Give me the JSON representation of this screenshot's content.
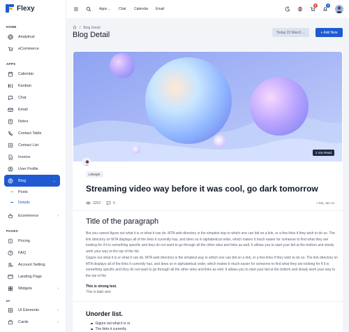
{
  "app": {
    "name": "Flexy"
  },
  "sidebar": {
    "sections": {
      "home": "HOME",
      "apps": "APPS",
      "pages": "PAGES",
      "ui": "UI"
    },
    "home_items": [
      {
        "label": "Analytical",
        "icon": "aperture-icon"
      },
      {
        "label": "eCommerce",
        "icon": "shopping-cart-icon"
      }
    ],
    "apps_items": [
      {
        "label": "Calendar",
        "icon": "calendar-icon"
      },
      {
        "label": "Kanban",
        "icon": "kanban-icon"
      },
      {
        "label": "Chat",
        "icon": "message-icon"
      },
      {
        "label": "Email",
        "icon": "mail-icon"
      },
      {
        "label": "Notes",
        "icon": "notes-icon"
      },
      {
        "label": "Contact Table",
        "icon": "phone-icon"
      },
      {
        "label": "Contact List",
        "icon": "list-icon"
      },
      {
        "label": "Invoice",
        "icon": "invoice-icon"
      },
      {
        "label": "User Profile",
        "icon": "user-circle-icon"
      },
      {
        "label": "Blog",
        "icon": "chart-donut-icon"
      }
    ],
    "blog_sub": [
      {
        "label": "Posts"
      },
      {
        "label": "Details"
      }
    ],
    "ecommerce_label": "Ecommerce",
    "pages_items": [
      {
        "label": "Pricing",
        "icon": "currency-icon"
      },
      {
        "label": "FAQ",
        "icon": "help-icon"
      },
      {
        "label": "Account Setting",
        "icon": "user-settings-icon"
      },
      {
        "label": "Landing Page",
        "icon": "app-window-icon"
      },
      {
        "label": "Widgets",
        "icon": "layout-icon"
      }
    ],
    "ui_items": [
      {
        "label": "UI Elements",
        "icon": "layout-grid-icon"
      },
      {
        "label": "Cards",
        "icon": "cards-icon"
      }
    ]
  },
  "topbar": {
    "links": [
      "Apps",
      "Chat",
      "Calendar",
      "Email"
    ],
    "cart_count": "5",
    "notif_count": "3"
  },
  "page": {
    "breadcrumb_current": "Blog Detail",
    "title": "Blog Detail",
    "date_filter": "Today 23 March",
    "add_button": "+ Add New"
  },
  "post": {
    "read_time": "2 min Read",
    "tag": "Lifestyle",
    "title": "Streaming video way before it was cool, go dark tomorrow",
    "views": "2252",
    "comments": "5",
    "date": "• Sat, Jan 14",
    "heading": "Title of the paragraph",
    "para1": "But you cannot figure out what it is or what it can do. MTA web directory is the simplest way in which one can bid on a link, or a few links if they wish to do so. The link directory on MTA displays all of the links it currently has, and does so in alphabetical order, which makes it much easier for someone to find what they are looking for if it is something specific and they do not want to go through all the other sites and links as well. It allows you to start your bid at the bottom and slowly work your way to the top of the list.",
    "para2": "Gigure out what it is or what it can do. MTA web directory is the simplest way in which one can bid on a link, or a few links if they wish to do so. The link directory on MTA displays all of the links it currently has, and does so in alphabetical order, which makes it much easier for someone to find what they are looking for if it is something specific and they do not want to go through all the other sites and links as well. It allows you to start your bid at the bottom and slowly work your way to the top of the",
    "strong": "This is strong text.",
    "italic": "This is italic text.",
    "list_heading": "Unorder list.",
    "list_items": [
      "Gigure out what it is or",
      "The links it currently"
    ]
  },
  "colors": {
    "primary": "#1f5ad1",
    "bg": "#f2f4f8"
  }
}
